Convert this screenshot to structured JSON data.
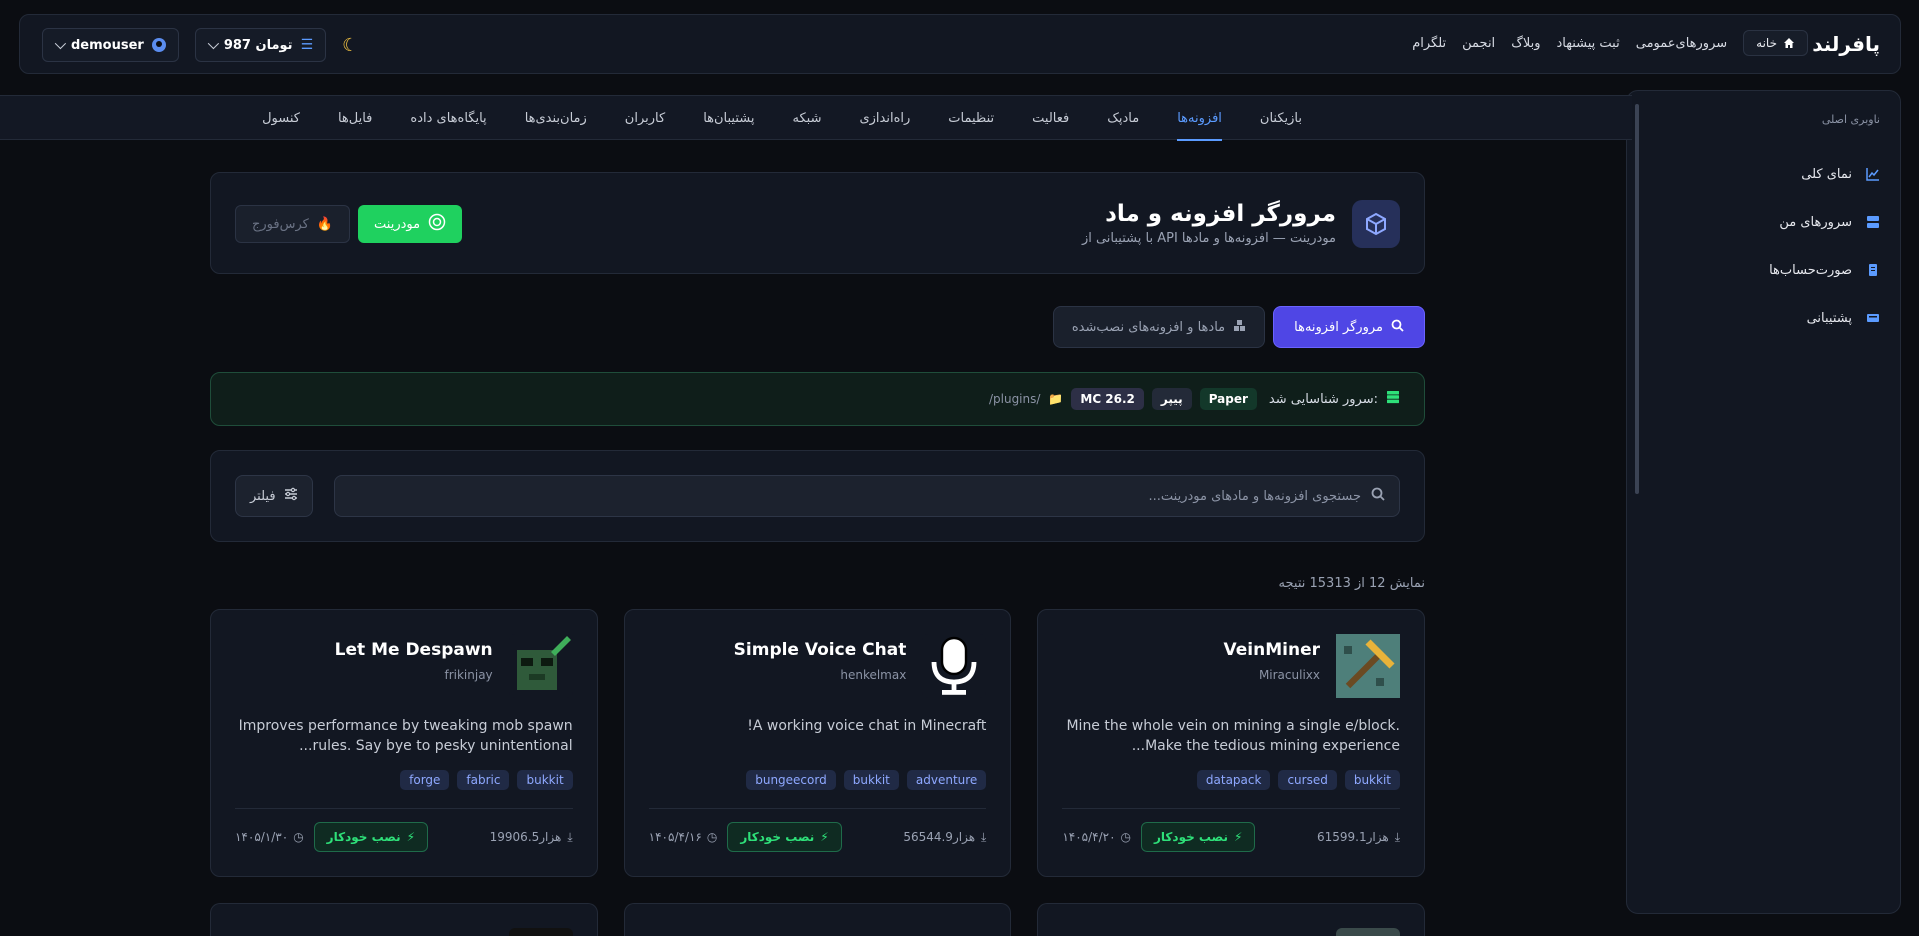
{
  "brand": "پافرلند",
  "topnav": {
    "home": "خانه",
    "items": [
      "سرورهای‌عمومی",
      "ثبت پیشنهاد",
      "وبلاگ",
      "انجمن",
      "تلگرام"
    ]
  },
  "account": {
    "balance": "987 تومان",
    "username": "demouser"
  },
  "sidebar": {
    "title": "ناوبری اصلی",
    "items": [
      {
        "label": "نمای کلی",
        "icon": "chart-icon"
      },
      {
        "label": "سرورهای من",
        "icon": "server-icon"
      },
      {
        "label": "صورت‌حساب‌ها",
        "icon": "invoice-icon"
      },
      {
        "label": "پشتیبانی",
        "icon": "support-icon"
      }
    ]
  },
  "tabs": [
    "بازیکنان",
    "افزونه‌ها",
    "مادپک",
    "فعالیت",
    "تنظیمات",
    "راه‌اندازی",
    "شبکه",
    "پشتیبان‌ها",
    "کاربران",
    "زمان‌بندی‌ها",
    "پایگاه‌های داده",
    "فایل‌ها",
    "کنسول"
  ],
  "active_tab": "افزونه‌ها",
  "header": {
    "title": "مرورگر افزونه و ماد",
    "subtitle": "با پشتیبانی از API مودرینت — افزونه‌ها و مادها",
    "modrinth_btn": "مودرینت",
    "curseforge_btn": "کرس‌فورج"
  },
  "modes": {
    "browse": "مرورگر افزونه‌ها",
    "installed": "مادها و افزونه‌های نصب‌شده"
  },
  "detect": {
    "label": "سرور شناسایی شد:",
    "software": "Paper",
    "software_fa": "پیپر",
    "version": "MC 26.2",
    "path": "/plugins/"
  },
  "search": {
    "placeholder": "جستجوی افزونه‌ها و مادهای مودرینت...",
    "filter": "فیلتر"
  },
  "results": "نمایش 12 از 15313 نتیجه",
  "auto_install": "نصب خودکار",
  "plugins": [
    {
      "name": "VeinMiner",
      "author": "Miraculixx",
      "desc": "Mine the whole vein on mining a single e/block. Make the tedious mining experience...",
      "tags": [
        "bukkit",
        "cursed",
        "datapack"
      ],
      "downloads": "61599.1هزار",
      "date": "۱۴۰۵/۴/۲۰",
      "img_color": "#3a6f6a"
    },
    {
      "name": "Simple Voice Chat",
      "author": "henkelmax",
      "desc": "A working voice chat in Minecraft!",
      "tags": [
        "adventure",
        "bukkit",
        "bungeecord"
      ],
      "downloads": "56544.9هزار",
      "date": "۱۴۰۵/۴/۱۶",
      "img_color": "#1b1e25"
    },
    {
      "name": "Let Me Despawn",
      "author": "frikinjay",
      "desc": "Improves performance by tweaking mob spawn rules. Say bye to pesky unintentional...",
      "tags": [
        "bukkit",
        "fabric",
        "forge"
      ],
      "downloads": "19906.5هزار",
      "date": "۱۴۰۵/۱/۳۰",
      "img_color": "#2f5a3a"
    }
  ]
}
